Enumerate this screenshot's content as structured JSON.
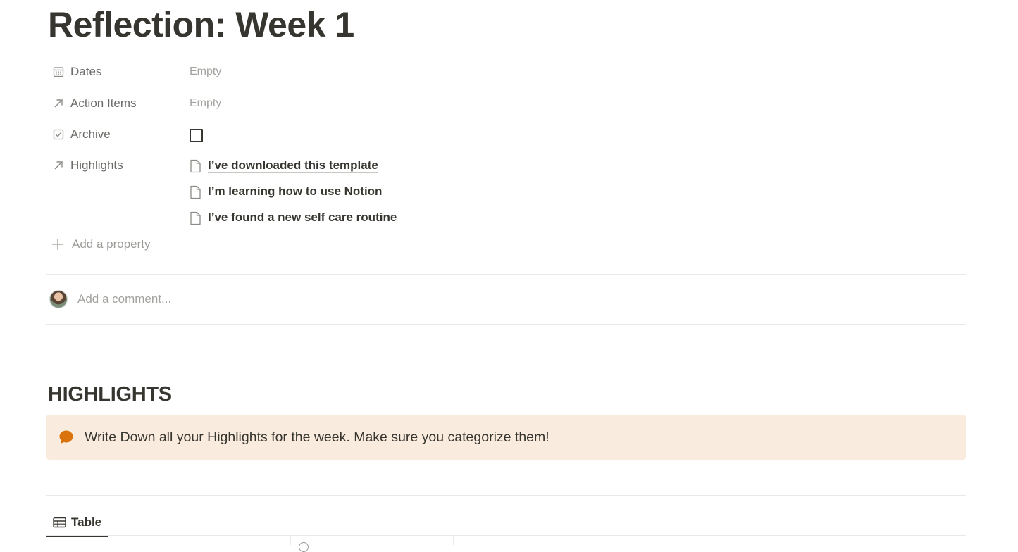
{
  "page": {
    "title": "Reflection: Week 1"
  },
  "properties": [
    {
      "icon": "calendar-icon",
      "label": "Dates",
      "value": "Empty"
    },
    {
      "icon": "relation-arrow-icon",
      "label": "Action Items",
      "value": "Empty"
    },
    {
      "icon": "checkbox-icon",
      "label": "Archive",
      "checked": false
    },
    {
      "icon": "relation-arrow-icon",
      "label": "Highlights"
    }
  ],
  "highlights_relations": [
    "I’ve downloaded this template",
    "I’m learning how to use Notion",
    "I’ve found a new self care routine"
  ],
  "add_property_label": "Add a property",
  "comment": {
    "placeholder": "Add a comment..."
  },
  "section": {
    "heading": "HIGHLIGHTS"
  },
  "callout": {
    "icon": "speech-bubble-icon",
    "text": "Write Down all your Highlights for the week. Make sure you categorize them!",
    "background": "#f9ebdd",
    "icon_color": "#d9730d"
  },
  "view_tab": {
    "icon": "table-icon",
    "label": "Table"
  }
}
